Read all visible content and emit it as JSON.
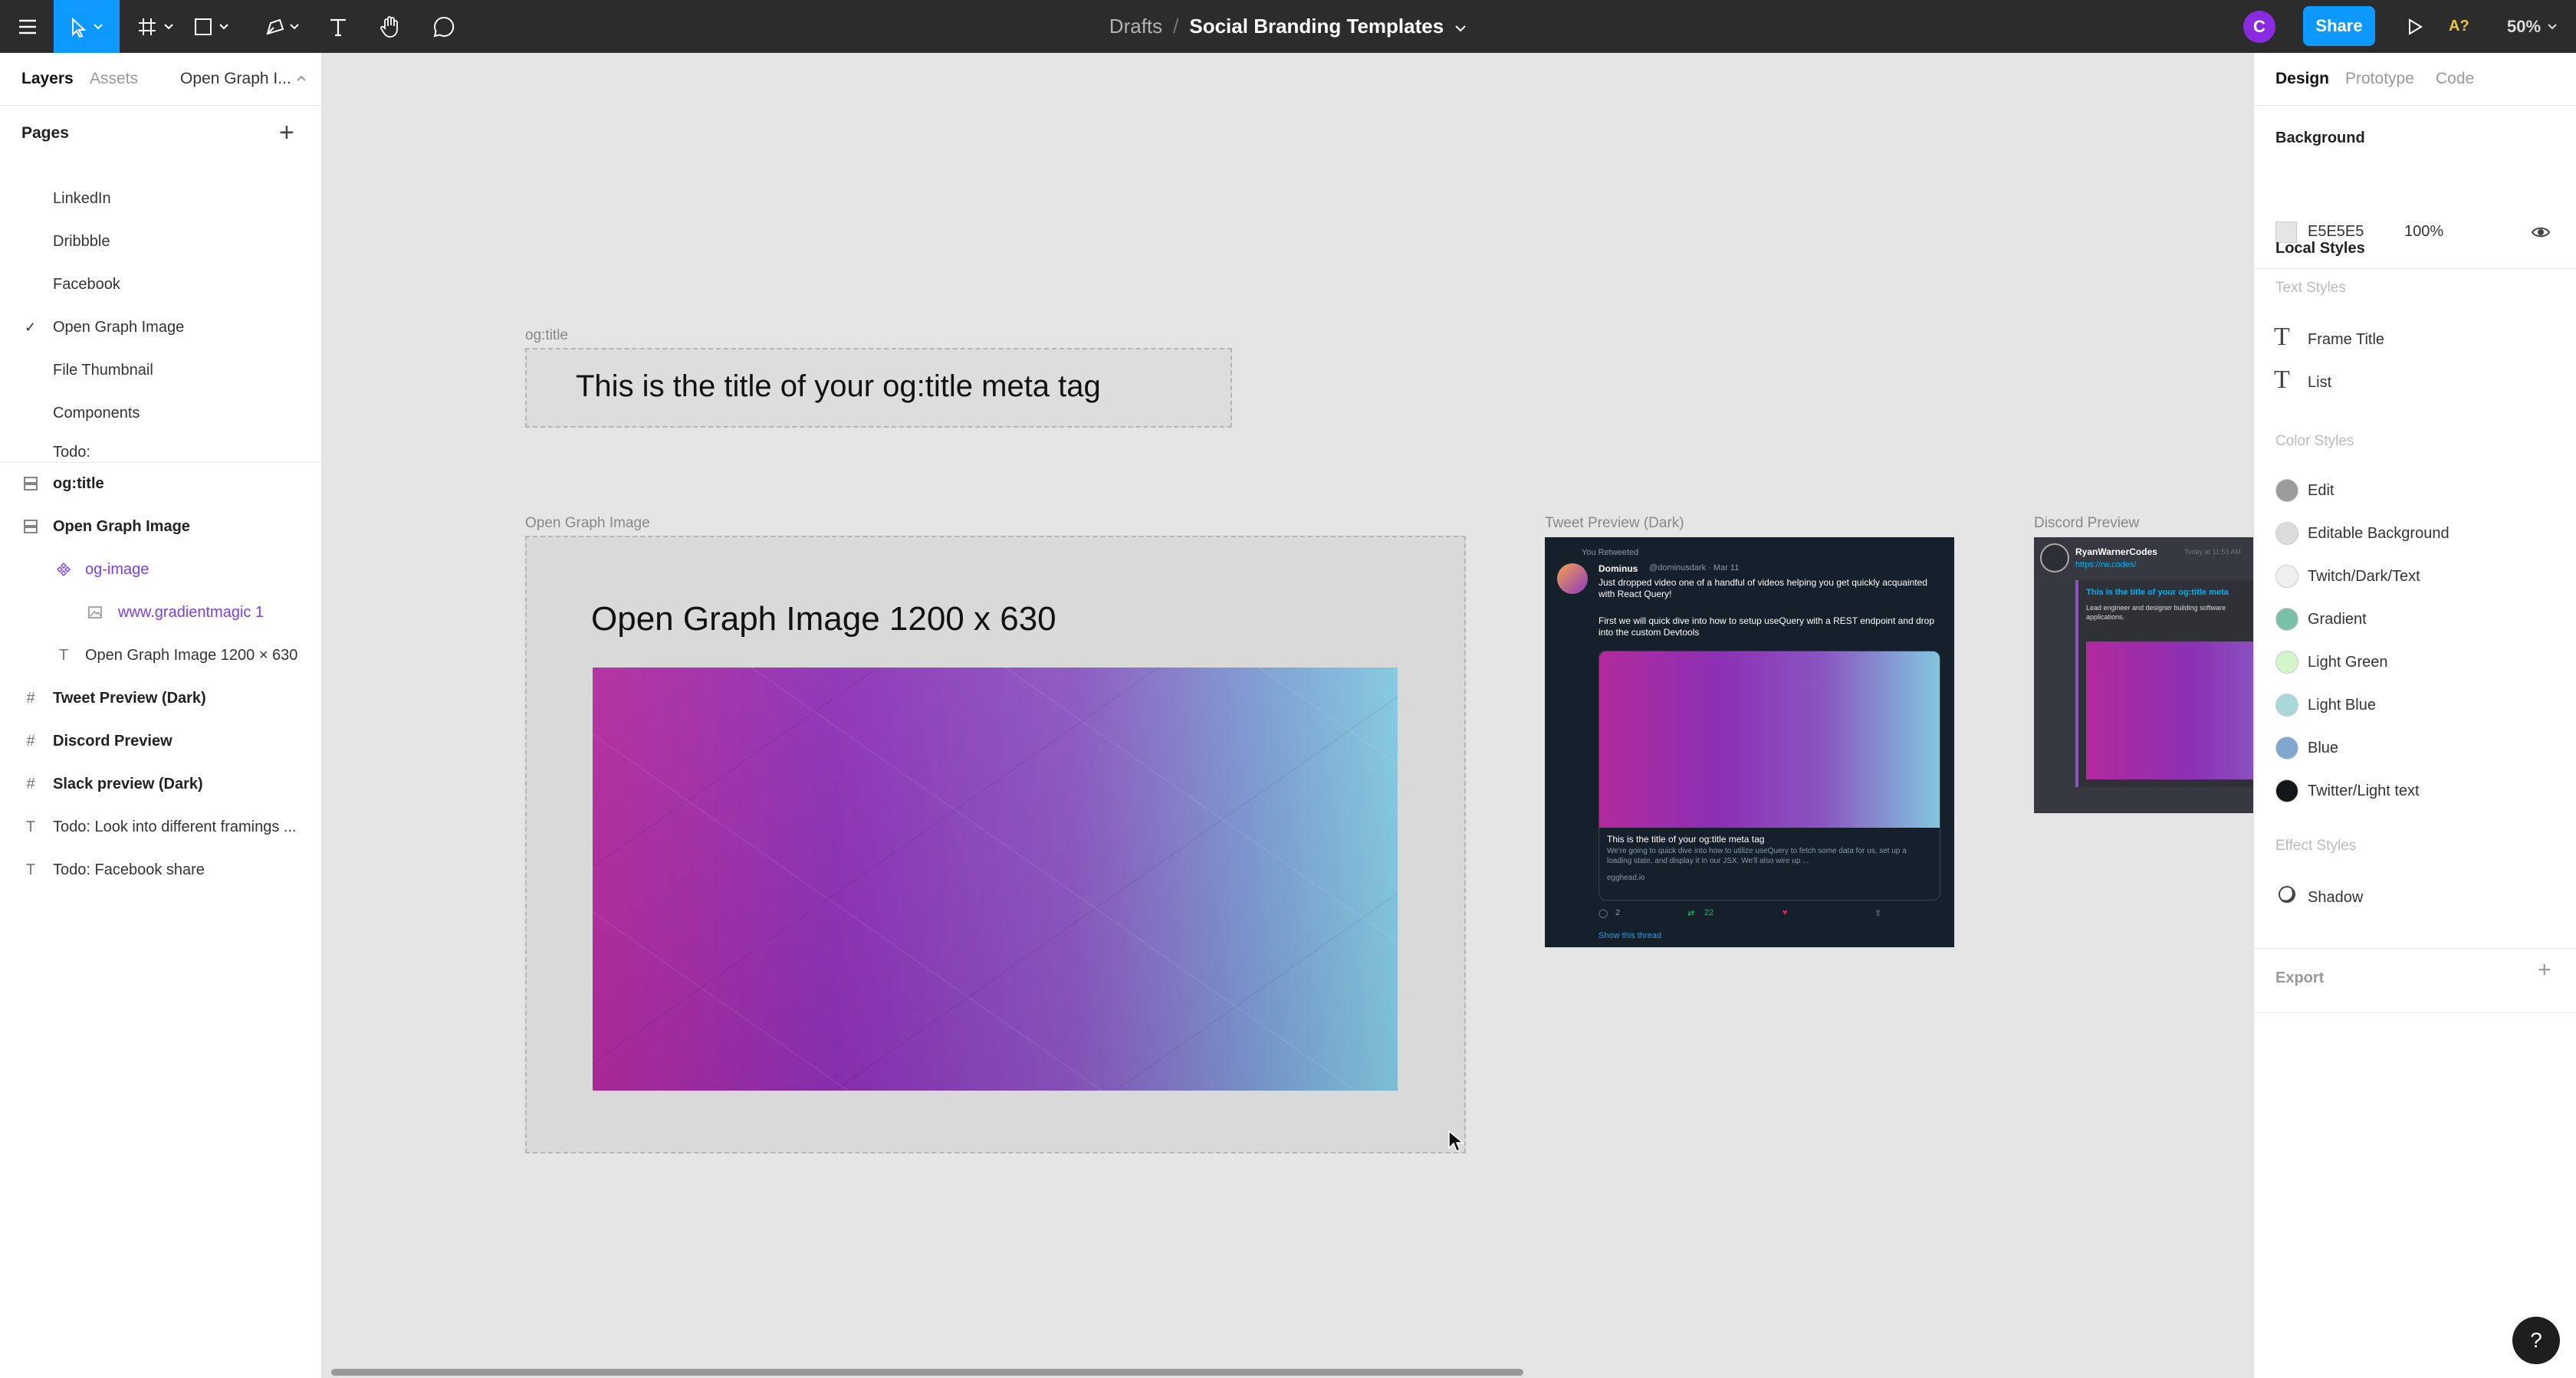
{
  "toolbar": {
    "breadcrumb_drafts": "Drafts",
    "breadcrumb_sep": "/",
    "file_name": "Social Branding Templates",
    "avatar_initial": "C",
    "share_label": "Share",
    "a11y_label": "A?",
    "zoom_label": "50%",
    "accent": "#0d99ff"
  },
  "left": {
    "tabs": [
      "Layers",
      "Assets",
      "Open Graph I..."
    ],
    "pages_label": "Pages",
    "pages": [
      {
        "label": "LinkedIn",
        "active": false
      },
      {
        "label": "Dribbble",
        "active": false
      },
      {
        "label": "Facebook",
        "active": false
      },
      {
        "label": "Open Graph Image",
        "active": true
      },
      {
        "label": "File Thumbnail",
        "active": false
      },
      {
        "label": "Components",
        "active": false
      },
      {
        "label": "Todo:",
        "active": false
      }
    ],
    "layers": [
      {
        "label": "og:title",
        "icon": "section-icon"
      },
      {
        "label": "Open Graph Image",
        "icon": "section-icon"
      },
      {
        "label": "og-image",
        "icon": "component-icon"
      },
      {
        "label": "www.gradientmagic 1",
        "icon": "image-icon"
      },
      {
        "label": "Open Graph Image 1200 × 630",
        "icon": "text-icon"
      },
      {
        "label": "Tweet Preview (Dark)",
        "icon": "frame-icon"
      },
      {
        "label": "Discord Preview",
        "icon": "frame-icon"
      },
      {
        "label": "Slack preview (Dark)",
        "icon": "frame-icon"
      },
      {
        "label": "Todo: Look into different framings ...",
        "icon": "text-icon"
      },
      {
        "label": "Todo: Facebook share",
        "icon": "text-icon"
      }
    ]
  },
  "canvas": {
    "ogtitle_label": "og:title",
    "ogtitle_text": "This is the title of your og:title meta tag",
    "ogimage_label": "Open Graph Image",
    "ogimage_heading": "Open Graph Image 1200 x 630",
    "tweet_label": "Tweet Preview (Dark)",
    "discord_label": "Discord Preview",
    "tweet": {
      "retweet_note": "You Retweeted",
      "name": "Dominus",
      "handle": "@dominusdark · Mar 11",
      "body1": "Just dropped video one of a handful of videos helping you get quickly acquainted with React Query!",
      "body2": "First we will quick dive into how to setup useQuery with a REST endpoint and drop into the custom Devtools",
      "card_title": "This is the title of your og:title meta tag",
      "card_desc": "We're going to quick dive into how to utilize useQuery to fetch some data for us, set up a loading state, and display it in our JSX. We'll also wire up ...",
      "card_url": "egghead.io",
      "replies": "2",
      "retweets": "22",
      "likes": "",
      "show_thread": "Show this thread"
    },
    "discord": {
      "name": "RyanWarnerCodes",
      "time": "Today at 11:53 AM",
      "link": "https://rw.codes/",
      "embed_title": "This is the title of your og:title meta",
      "embed_desc": "Lead engineer and designer building software applications."
    }
  },
  "right": {
    "tabs": [
      "Design",
      "Prototype",
      "Code"
    ],
    "background_label": "Background",
    "bg_hex": "E5E5E5",
    "bg_opacity": "100%",
    "local_styles_label": "Local Styles",
    "text_styles_label": "Text Styles",
    "text_styles": [
      "Frame Title",
      "List"
    ],
    "color_styles_label": "Color Styles",
    "color_styles": [
      {
        "label": "Edit",
        "color": "#9b9b9b"
      },
      {
        "label": "Editable Background",
        "color": "#dcdcdc"
      },
      {
        "label": "Twitch/Dark/Text",
        "color": "#efeff1"
      },
      {
        "label": "Gradient",
        "color": "#7bbfa8"
      },
      {
        "label": "Light Green",
        "color": "#d4f5cc"
      },
      {
        "label": "Light Blue",
        "color": "#a8d8da"
      },
      {
        "label": "Blue",
        "color": "#7fa6cf"
      },
      {
        "label": "Twitter/Light text",
        "color": "#14171a"
      }
    ],
    "effect_styles_label": "Effect Styles",
    "effect_styles": [
      "Shadow"
    ],
    "export_label": "Export"
  },
  "help_label": "?"
}
